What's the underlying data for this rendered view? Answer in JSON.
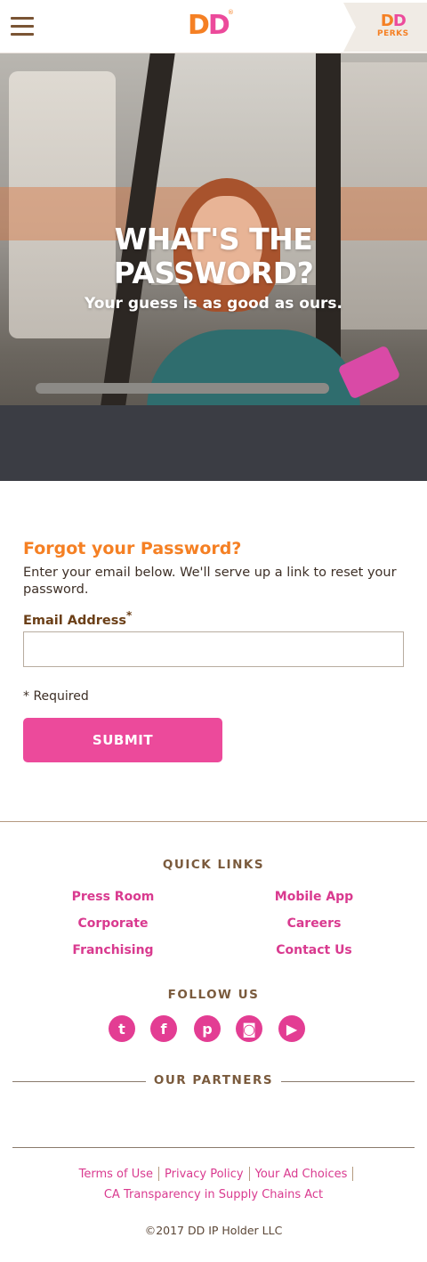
{
  "header": {
    "logo_text_1": "D",
    "logo_text_2": "D",
    "perks_dd_1": "D",
    "perks_dd_2": "D",
    "perks_label": "PERKS"
  },
  "hero": {
    "title_line1": "WHAT'S THE",
    "title_line2": "PASSWORD?",
    "subtitle": "Your guess is as good as ours."
  },
  "form": {
    "title": "Forgot your Password?",
    "description": "Enter your email below. We'll serve up a link to reset your password.",
    "email_label": "Email Address",
    "email_required_mark": "*",
    "email_value": "",
    "required_note": "* Required",
    "submit_label": "SUBMIT"
  },
  "footer": {
    "quick_links_heading": "QUICK LINKS",
    "quick_links": [
      "Press Room",
      "Mobile App",
      "Corporate",
      "Careers",
      "Franchising",
      "Contact Us"
    ],
    "follow_heading": "FOLLOW US",
    "social_icons": [
      "twitter-icon",
      "facebook-icon",
      "pinterest-icon",
      "instagram-icon",
      "youtube-icon"
    ],
    "social_glyphs": [
      "t",
      "f",
      "p",
      "◙",
      "▶"
    ],
    "partners_heading": "OUR PARTNERS",
    "legal_links": [
      "Terms of Use",
      "Privacy Policy",
      "Your Ad Choices"
    ],
    "ca_link": "CA Transparency in Supply Chains Act",
    "copyright": "©2017 DD IP Holder LLC"
  },
  "colors": {
    "brand_orange": "#f58024",
    "brand_pink": "#ec4a9b",
    "brand_brown": "#7a5434"
  }
}
